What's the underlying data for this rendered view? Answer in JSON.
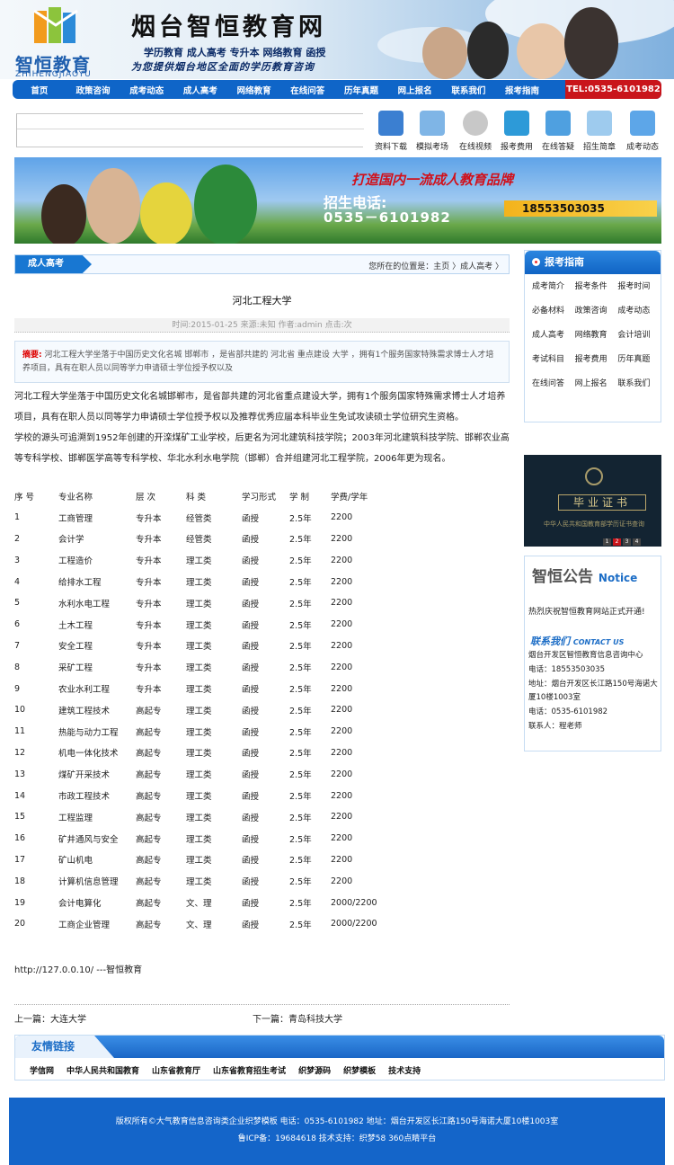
{
  "brand": {
    "logo_cn": "智恒教育",
    "logo_en": "ZHIHENGJIAOYU",
    "title": "烟台智恒教育网",
    "slogan1": "学历教育 成人高考 专升本 网络教育 函授",
    "slogan2": "为您提供烟台地区全面的学历教育咨询"
  },
  "nav": {
    "items": [
      "首页",
      "政策咨询",
      "成考动态",
      "成人高考",
      "网络教育",
      "在线问答",
      "历年真题",
      "网上报名",
      "联系我们",
      "报考指南"
    ],
    "tel": "TEL:0535-6101982"
  },
  "quick": [
    "资料下载",
    "模拟考场",
    "在线视频",
    "报考费用",
    "在线答疑",
    "招生简章",
    "成考动态"
  ],
  "banner": {
    "slogan": "打造国内一流成人教育品牌",
    "tel_label": "招生电话:",
    "tel": "0535－6101982",
    "mobile": "18553503035"
  },
  "crumb": {
    "tab": "成人高考",
    "text": "您所在的位置是：主页 〉成人高考 〉"
  },
  "article": {
    "title": "河北工程大学",
    "meta": "时间:2015-01-25  来源:未知  作者:admin  点击:次",
    "abstract_label": "摘要:",
    "abstract": "河北工程大学坐落于中国历史文化名城 邯郸市 ，是省部共建的 河北省 重点建设 大学 ，拥有1个服务国家特殊需求博士人才培养项目，具有在职人员以同等学力申请硕士学位授予权以及",
    "para1": "河北工程大学坐落于中国历史文化名城邯郸市，是省部共建的河北省重点建设大学，拥有1个服务国家特殊需求博士人才培养项目，具有在职人员以同等学力申请硕士学位授予权以及推荐优秀应届本科毕业生免试攻读硕士学位研究生资格。",
    "para2": "学校的源头可追溯到1952年创建的开滦煤矿工业学校，后更名为河北建筑科技学院；2003年河北建筑科技学院、邯郸农业高等专科学校、邯郸医学高等专科学校、华北水利水电学院（邯郸）合并组建河北工程学院，2006年更为现名。",
    "table_headers": [
      "序 号",
      "专业名称",
      "层 次",
      "科 类",
      "学习形式",
      "学 制",
      "学费/学年"
    ],
    "rows": [
      [
        "1",
        "工商管理",
        "专升本",
        "经管类",
        "函授",
        "2.5年",
        "2200"
      ],
      [
        "2",
        "会计学",
        "专升本",
        "经管类",
        "函授",
        "2.5年",
        "2200"
      ],
      [
        "3",
        "工程造价",
        "专升本",
        "理工类",
        "函授",
        "2.5年",
        "2200"
      ],
      [
        "4",
        "给排水工程",
        "专升本",
        "理工类",
        "函授",
        "2.5年",
        "2200"
      ],
      [
        "5",
        "水利水电工程",
        "专升本",
        "理工类",
        "函授",
        "2.5年",
        "2200"
      ],
      [
        "6",
        "土木工程",
        "专升本",
        "理工类",
        "函授",
        "2.5年",
        "2200"
      ],
      [
        "7",
        "安全工程",
        "专升本",
        "理工类",
        "函授",
        "2.5年",
        "2200"
      ],
      [
        "8",
        "采矿工程",
        "专升本",
        "理工类",
        "函授",
        "2.5年",
        "2200"
      ],
      [
        "9",
        "农业水利工程",
        "专升本",
        "理工类",
        "函授",
        "2.5年",
        "2200"
      ],
      [
        "10",
        "建筑工程技术",
        "高起专",
        "理工类",
        "函授",
        "2.5年",
        "2200"
      ],
      [
        "11",
        "热能与动力工程",
        "高起专",
        "理工类",
        "函授",
        "2.5年",
        "2200"
      ],
      [
        "12",
        "机电一体化技术",
        "高起专",
        "理工类",
        "函授",
        "2.5年",
        "2200"
      ],
      [
        "13",
        "煤矿开采技术",
        "高起专",
        "理工类",
        "函授",
        "2.5年",
        "2200"
      ],
      [
        "14",
        "市政工程技术",
        "高起专",
        "理工类",
        "函授",
        "2.5年",
        "2200"
      ],
      [
        "15",
        "工程监理",
        "高起专",
        "理工类",
        "函授",
        "2.5年",
        "2200"
      ],
      [
        "16",
        "矿井通风与安全",
        "高起专",
        "理工类",
        "函授",
        "2.5年",
        "2200"
      ],
      [
        "17",
        "矿山机电",
        "高起专",
        "理工类",
        "函授",
        "2.5年",
        "2200"
      ],
      [
        "18",
        "计算机信息管理",
        "高起专",
        "理工类",
        "函授",
        "2.5年",
        "2200"
      ],
      [
        "19",
        "会计电算化",
        "高起专",
        "文、理",
        "函授",
        "2.5年",
        "2000/2200"
      ],
      [
        "20",
        "工商企业管理",
        "高起专",
        "文、理",
        "函授",
        "2.5年",
        "2000/2200"
      ]
    ],
    "site_url": "http://127.0.0.10/ ---智恒教育",
    "prev": "上一篇：大连大学",
    "next": "下一篇：青岛科技大学"
  },
  "sidebar": {
    "guide_title": "报考指南",
    "guide_items": [
      "成考简介",
      "报考条件",
      "报考时间",
      "必备材料",
      "政策咨询",
      "成考动态",
      "成人高考",
      "网络教育",
      "会计培训",
      "考试科目",
      "报考费用",
      "历年真题",
      "在线问答",
      "网上报名",
      "联系我们"
    ],
    "cert_title": "毕业证书",
    "cert_sub": "中华人民共和国教育部学历证书查询",
    "cert_pages": [
      "1",
      "2",
      "3",
      "4"
    ],
    "notice_title": "智恒公告",
    "notice_en": "Notice",
    "notice_text": "热烈庆祝智恒教育网站正式开通!",
    "contact_cn": "联系我们",
    "contact_en": "CONTACT US",
    "contact_lines": [
      "烟台开发区智恒教育信息咨询中心",
      "电话：18553503035",
      "地址：烟台开发区长江路150号海诺大厦10楼1003室",
      "电话：0535-6101982",
      "联系人：程老师"
    ]
  },
  "links": {
    "title": "友情链接",
    "items": [
      "学信网",
      "中华人民共和国教育",
      "山东省教育厅",
      "山东省教育招生考试",
      "织梦源码",
      "织梦模板",
      "技术支持"
    ]
  },
  "footer": {
    "line1": "版权所有©大气教育信息咨询类企业织梦模板  电话：0535-6101982  地址：烟台开发区长江路150号海诺大厦10楼1003室",
    "line2": "鲁ICP备：19684618  技术支持：织梦58  360点睛平台"
  },
  "colors": {
    "nav": "#0f65c8",
    "tel": "#c9151b",
    "accent": "#1c6dc6"
  }
}
